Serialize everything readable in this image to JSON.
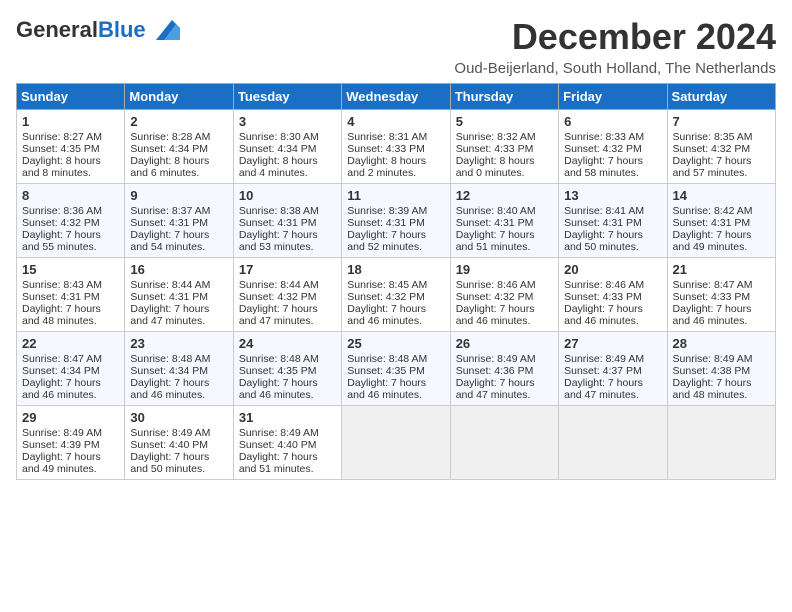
{
  "header": {
    "logo_general": "General",
    "logo_blue": "Blue",
    "month_title": "December 2024",
    "location": "Oud-Beijerland, South Holland, The Netherlands"
  },
  "weekdays": [
    "Sunday",
    "Monday",
    "Tuesday",
    "Wednesday",
    "Thursday",
    "Friday",
    "Saturday"
  ],
  "weeks": [
    [
      {
        "day": "1",
        "sunrise": "Sunrise: 8:27 AM",
        "sunset": "Sunset: 4:35 PM",
        "daylight": "Daylight: 8 hours and 8 minutes."
      },
      {
        "day": "2",
        "sunrise": "Sunrise: 8:28 AM",
        "sunset": "Sunset: 4:34 PM",
        "daylight": "Daylight: 8 hours and 6 minutes."
      },
      {
        "day": "3",
        "sunrise": "Sunrise: 8:30 AM",
        "sunset": "Sunset: 4:34 PM",
        "daylight": "Daylight: 8 hours and 4 minutes."
      },
      {
        "day": "4",
        "sunrise": "Sunrise: 8:31 AM",
        "sunset": "Sunset: 4:33 PM",
        "daylight": "Daylight: 8 hours and 2 minutes."
      },
      {
        "day": "5",
        "sunrise": "Sunrise: 8:32 AM",
        "sunset": "Sunset: 4:33 PM",
        "daylight": "Daylight: 8 hours and 0 minutes."
      },
      {
        "day": "6",
        "sunrise": "Sunrise: 8:33 AM",
        "sunset": "Sunset: 4:32 PM",
        "daylight": "Daylight: 7 hours and 58 minutes."
      },
      {
        "day": "7",
        "sunrise": "Sunrise: 8:35 AM",
        "sunset": "Sunset: 4:32 PM",
        "daylight": "Daylight: 7 hours and 57 minutes."
      }
    ],
    [
      {
        "day": "8",
        "sunrise": "Sunrise: 8:36 AM",
        "sunset": "Sunset: 4:32 PM",
        "daylight": "Daylight: 7 hours and 55 minutes."
      },
      {
        "day": "9",
        "sunrise": "Sunrise: 8:37 AM",
        "sunset": "Sunset: 4:31 PM",
        "daylight": "Daylight: 7 hours and 54 minutes."
      },
      {
        "day": "10",
        "sunrise": "Sunrise: 8:38 AM",
        "sunset": "Sunset: 4:31 PM",
        "daylight": "Daylight: 7 hours and 53 minutes."
      },
      {
        "day": "11",
        "sunrise": "Sunrise: 8:39 AM",
        "sunset": "Sunset: 4:31 PM",
        "daylight": "Daylight: 7 hours and 52 minutes."
      },
      {
        "day": "12",
        "sunrise": "Sunrise: 8:40 AM",
        "sunset": "Sunset: 4:31 PM",
        "daylight": "Daylight: 7 hours and 51 minutes."
      },
      {
        "day": "13",
        "sunrise": "Sunrise: 8:41 AM",
        "sunset": "Sunset: 4:31 PM",
        "daylight": "Daylight: 7 hours and 50 minutes."
      },
      {
        "day": "14",
        "sunrise": "Sunrise: 8:42 AM",
        "sunset": "Sunset: 4:31 PM",
        "daylight": "Daylight: 7 hours and 49 minutes."
      }
    ],
    [
      {
        "day": "15",
        "sunrise": "Sunrise: 8:43 AM",
        "sunset": "Sunset: 4:31 PM",
        "daylight": "Daylight: 7 hours and 48 minutes."
      },
      {
        "day": "16",
        "sunrise": "Sunrise: 8:44 AM",
        "sunset": "Sunset: 4:31 PM",
        "daylight": "Daylight: 7 hours and 47 minutes."
      },
      {
        "day": "17",
        "sunrise": "Sunrise: 8:44 AM",
        "sunset": "Sunset: 4:32 PM",
        "daylight": "Daylight: 7 hours and 47 minutes."
      },
      {
        "day": "18",
        "sunrise": "Sunrise: 8:45 AM",
        "sunset": "Sunset: 4:32 PM",
        "daylight": "Daylight: 7 hours and 46 minutes."
      },
      {
        "day": "19",
        "sunrise": "Sunrise: 8:46 AM",
        "sunset": "Sunset: 4:32 PM",
        "daylight": "Daylight: 7 hours and 46 minutes."
      },
      {
        "day": "20",
        "sunrise": "Sunrise: 8:46 AM",
        "sunset": "Sunset: 4:33 PM",
        "daylight": "Daylight: 7 hours and 46 minutes."
      },
      {
        "day": "21",
        "sunrise": "Sunrise: 8:47 AM",
        "sunset": "Sunset: 4:33 PM",
        "daylight": "Daylight: 7 hours and 46 minutes."
      }
    ],
    [
      {
        "day": "22",
        "sunrise": "Sunrise: 8:47 AM",
        "sunset": "Sunset: 4:34 PM",
        "daylight": "Daylight: 7 hours and 46 minutes."
      },
      {
        "day": "23",
        "sunrise": "Sunrise: 8:48 AM",
        "sunset": "Sunset: 4:34 PM",
        "daylight": "Daylight: 7 hours and 46 minutes."
      },
      {
        "day": "24",
        "sunrise": "Sunrise: 8:48 AM",
        "sunset": "Sunset: 4:35 PM",
        "daylight": "Daylight: 7 hours and 46 minutes."
      },
      {
        "day": "25",
        "sunrise": "Sunrise: 8:48 AM",
        "sunset": "Sunset: 4:35 PM",
        "daylight": "Daylight: 7 hours and 46 minutes."
      },
      {
        "day": "26",
        "sunrise": "Sunrise: 8:49 AM",
        "sunset": "Sunset: 4:36 PM",
        "daylight": "Daylight: 7 hours and 47 minutes."
      },
      {
        "day": "27",
        "sunrise": "Sunrise: 8:49 AM",
        "sunset": "Sunset: 4:37 PM",
        "daylight": "Daylight: 7 hours and 47 minutes."
      },
      {
        "day": "28",
        "sunrise": "Sunrise: 8:49 AM",
        "sunset": "Sunset: 4:38 PM",
        "daylight": "Daylight: 7 hours and 48 minutes."
      }
    ],
    [
      {
        "day": "29",
        "sunrise": "Sunrise: 8:49 AM",
        "sunset": "Sunset: 4:39 PM",
        "daylight": "Daylight: 7 hours and 49 minutes."
      },
      {
        "day": "30",
        "sunrise": "Sunrise: 8:49 AM",
        "sunset": "Sunset: 4:40 PM",
        "daylight": "Daylight: 7 hours and 50 minutes."
      },
      {
        "day": "31",
        "sunrise": "Sunrise: 8:49 AM",
        "sunset": "Sunset: 4:40 PM",
        "daylight": "Daylight: 7 hours and 51 minutes."
      },
      null,
      null,
      null,
      null
    ]
  ]
}
